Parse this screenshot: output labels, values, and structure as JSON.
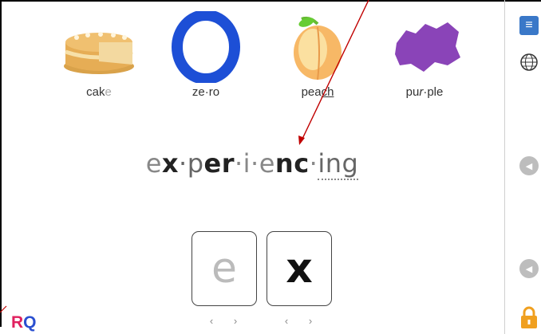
{
  "pictures": [
    {
      "icon": "cake-icon",
      "caption_main": "cak",
      "caption_faded": "e"
    },
    {
      "icon": "zero-icon",
      "caption_main": "ze·ro"
    },
    {
      "icon": "peach-icon",
      "caption_main": "pea",
      "caption_underlined": "ch"
    },
    {
      "icon": "purple-icon",
      "caption_main": "pu",
      "caption_r": "r",
      "caption_rest": "·ple"
    }
  ],
  "word": {
    "p1": "e",
    "p2": "x",
    "p3": "·p",
    "p4": "er",
    "p5": "·i·",
    "p6": "e",
    "p7": "nc",
    "p8": "·",
    "p9": "ing"
  },
  "tiles": [
    {
      "letter": "e"
    },
    {
      "letter": "x"
    }
  ],
  "nav": {
    "prev": "‹",
    "next": "›"
  },
  "logo": {
    "r": "R",
    "q": "Q"
  },
  "sidebar": {
    "menu_icon": "≡",
    "speaker_glyph": "◀"
  },
  "colors": {
    "accent": "#3a78c8",
    "arrow": "#c00000",
    "logo_blue": "#2a4fd0",
    "logo_pink": "#e0215f",
    "lock": "#f0a020"
  }
}
